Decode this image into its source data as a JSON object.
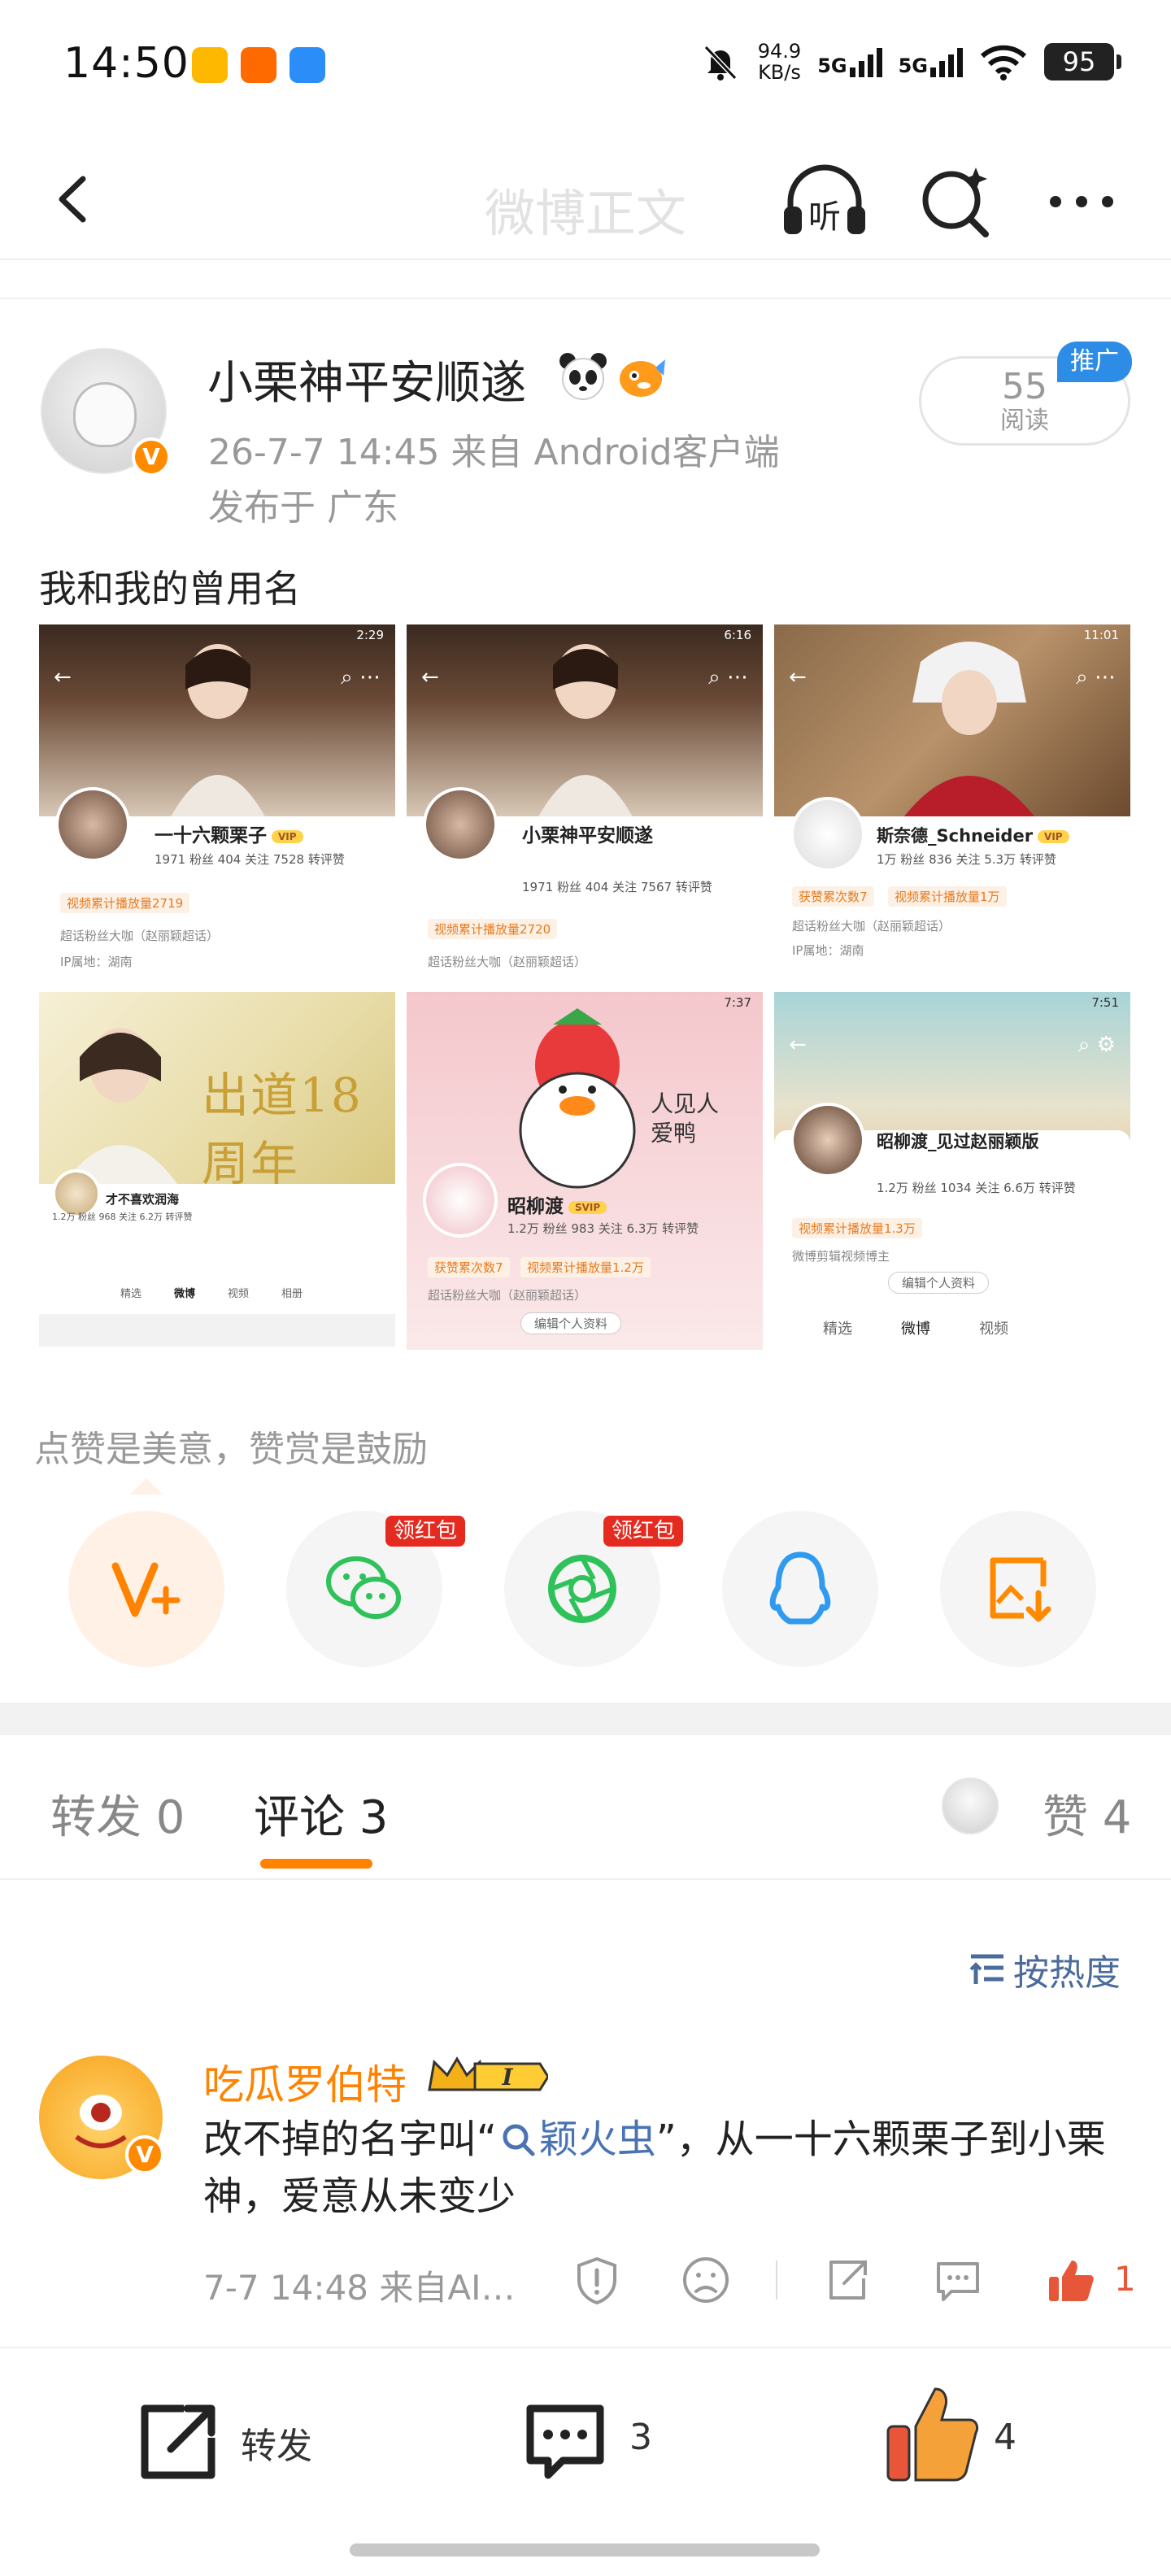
{
  "status_bar": {
    "time": "14:50",
    "net_speed_value": "94.9",
    "net_speed_unit": "KB/s",
    "signal1": "5G",
    "signal2": "5G",
    "battery": "95"
  },
  "nav": {
    "title": "微博正文",
    "listen_label": "听"
  },
  "post": {
    "author": "小栗神平安顺遂",
    "time_source": "26-7-7 14:45  来自 Android客户端",
    "location": "发布于 广东",
    "read_count": "55",
    "read_label": "阅读",
    "promo_tag": "推广",
    "text": "我和我的曾用名"
  },
  "images": [
    {
      "status_time": "2:29",
      "name": "一十六颗栗子",
      "stats": "1971 粉丝   404 关注   7528 转评赞",
      "tag": "视频累计播放量2719",
      "line1": "超话粉丝大咖（赵丽颖超话）",
      "line2": "IP属地：湖南"
    },
    {
      "status_time": "6:16",
      "name": "小栗神平安顺遂",
      "stats": "1971 粉丝   404 关注   7567 转评赞",
      "tag": "视频累计播放量2720",
      "line1": "超话粉丝大咖（赵丽颖超话）"
    },
    {
      "status_time": "11:01",
      "name": "斯奈德_Schneider",
      "stats": "1万 粉丝   836 关注   5.3万 转评赞",
      "tag": "获赞累次数7",
      "tag2": "视频累计播放量1万",
      "line1": "超话粉丝大咖（赵丽颖超话）",
      "line2": "IP属地：湖南"
    },
    {
      "banner": "出道18周年",
      "name": "才不喜欢润海",
      "stats": "1.2万 粉丝   968 关注   6.2万 转评赞",
      "tab1": "精选",
      "tab2": "微博",
      "tab3": "视频",
      "tab4": "相册"
    },
    {
      "status_time": "7:37",
      "sticker": "人见人爱鸭",
      "name": "昭柳渡",
      "stats": "1.2万 粉丝   983 关注   6.3万 转评赞",
      "tag": "获赞累次数7",
      "tag2": "视频累计播放量1.2万",
      "line1": "超话粉丝大咖（赵丽颖超话）",
      "edit": "编辑个人资料"
    },
    {
      "status_time": "7:51",
      "name": "昭柳渡_见过赵丽颖版",
      "stats": "1.2万 粉丝   1034 关注   6.6万 转评赞",
      "tag": "视频累计播放量1.3万",
      "line1": "微博剪辑视频博主",
      "edit": "编辑个人资料",
      "tab1": "精选",
      "tab2": "微博",
      "tab3": "视频"
    }
  ],
  "reward": {
    "text": "点赞是美意，赞赏是鼓励",
    "hongbao1": "领红包",
    "hongbao2": "领红包"
  },
  "tabs": {
    "repost": "转发 0",
    "comment": "评论 3",
    "like": "赞 4"
  },
  "sort_label": "按热度",
  "comment": {
    "user": "吃瓜罗伯特",
    "level": "I",
    "text_before": "改不掉的名字叫“",
    "link": "颖火虫",
    "text_after": "”，从一十六颗栗子到小栗神，爱意从未变少",
    "meta": "7-7 14:48  来自AI…",
    "like_count": "1"
  },
  "bottom_bar": {
    "repost": "转发",
    "comment_count": "3",
    "like_count": "4"
  },
  "colors": {
    "accent": "#ff8200",
    "link": "#4a73b4",
    "promo": "#2d8ce6",
    "hongbao": "#e52a1f"
  }
}
